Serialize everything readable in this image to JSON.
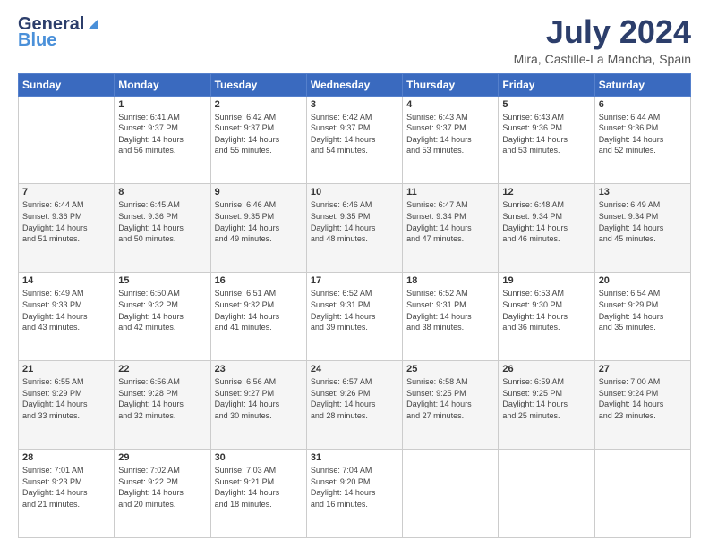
{
  "header": {
    "logo_general": "General",
    "logo_blue": "Blue",
    "main_title": "July 2024",
    "subtitle": "Mira, Castille-La Mancha, Spain"
  },
  "calendar": {
    "days_of_week": [
      "Sunday",
      "Monday",
      "Tuesday",
      "Wednesday",
      "Thursday",
      "Friday",
      "Saturday"
    ],
    "weeks": [
      [
        {
          "num": "",
          "info": ""
        },
        {
          "num": "1",
          "info": "Sunrise: 6:41 AM\nSunset: 9:37 PM\nDaylight: 14 hours\nand 56 minutes."
        },
        {
          "num": "2",
          "info": "Sunrise: 6:42 AM\nSunset: 9:37 PM\nDaylight: 14 hours\nand 55 minutes."
        },
        {
          "num": "3",
          "info": "Sunrise: 6:42 AM\nSunset: 9:37 PM\nDaylight: 14 hours\nand 54 minutes."
        },
        {
          "num": "4",
          "info": "Sunrise: 6:43 AM\nSunset: 9:37 PM\nDaylight: 14 hours\nand 53 minutes."
        },
        {
          "num": "5",
          "info": "Sunrise: 6:43 AM\nSunset: 9:36 PM\nDaylight: 14 hours\nand 53 minutes."
        },
        {
          "num": "6",
          "info": "Sunrise: 6:44 AM\nSunset: 9:36 PM\nDaylight: 14 hours\nand 52 minutes."
        }
      ],
      [
        {
          "num": "7",
          "info": "Sunrise: 6:44 AM\nSunset: 9:36 PM\nDaylight: 14 hours\nand 51 minutes."
        },
        {
          "num": "8",
          "info": "Sunrise: 6:45 AM\nSunset: 9:36 PM\nDaylight: 14 hours\nand 50 minutes."
        },
        {
          "num": "9",
          "info": "Sunrise: 6:46 AM\nSunset: 9:35 PM\nDaylight: 14 hours\nand 49 minutes."
        },
        {
          "num": "10",
          "info": "Sunrise: 6:46 AM\nSunset: 9:35 PM\nDaylight: 14 hours\nand 48 minutes."
        },
        {
          "num": "11",
          "info": "Sunrise: 6:47 AM\nSunset: 9:34 PM\nDaylight: 14 hours\nand 47 minutes."
        },
        {
          "num": "12",
          "info": "Sunrise: 6:48 AM\nSunset: 9:34 PM\nDaylight: 14 hours\nand 46 minutes."
        },
        {
          "num": "13",
          "info": "Sunrise: 6:49 AM\nSunset: 9:34 PM\nDaylight: 14 hours\nand 45 minutes."
        }
      ],
      [
        {
          "num": "14",
          "info": "Sunrise: 6:49 AM\nSunset: 9:33 PM\nDaylight: 14 hours\nand 43 minutes."
        },
        {
          "num": "15",
          "info": "Sunrise: 6:50 AM\nSunset: 9:32 PM\nDaylight: 14 hours\nand 42 minutes."
        },
        {
          "num": "16",
          "info": "Sunrise: 6:51 AM\nSunset: 9:32 PM\nDaylight: 14 hours\nand 41 minutes."
        },
        {
          "num": "17",
          "info": "Sunrise: 6:52 AM\nSunset: 9:31 PM\nDaylight: 14 hours\nand 39 minutes."
        },
        {
          "num": "18",
          "info": "Sunrise: 6:52 AM\nSunset: 9:31 PM\nDaylight: 14 hours\nand 38 minutes."
        },
        {
          "num": "19",
          "info": "Sunrise: 6:53 AM\nSunset: 9:30 PM\nDaylight: 14 hours\nand 36 minutes."
        },
        {
          "num": "20",
          "info": "Sunrise: 6:54 AM\nSunset: 9:29 PM\nDaylight: 14 hours\nand 35 minutes."
        }
      ],
      [
        {
          "num": "21",
          "info": "Sunrise: 6:55 AM\nSunset: 9:29 PM\nDaylight: 14 hours\nand 33 minutes."
        },
        {
          "num": "22",
          "info": "Sunrise: 6:56 AM\nSunset: 9:28 PM\nDaylight: 14 hours\nand 32 minutes."
        },
        {
          "num": "23",
          "info": "Sunrise: 6:56 AM\nSunset: 9:27 PM\nDaylight: 14 hours\nand 30 minutes."
        },
        {
          "num": "24",
          "info": "Sunrise: 6:57 AM\nSunset: 9:26 PM\nDaylight: 14 hours\nand 28 minutes."
        },
        {
          "num": "25",
          "info": "Sunrise: 6:58 AM\nSunset: 9:25 PM\nDaylight: 14 hours\nand 27 minutes."
        },
        {
          "num": "26",
          "info": "Sunrise: 6:59 AM\nSunset: 9:25 PM\nDaylight: 14 hours\nand 25 minutes."
        },
        {
          "num": "27",
          "info": "Sunrise: 7:00 AM\nSunset: 9:24 PM\nDaylight: 14 hours\nand 23 minutes."
        }
      ],
      [
        {
          "num": "28",
          "info": "Sunrise: 7:01 AM\nSunset: 9:23 PM\nDaylight: 14 hours\nand 21 minutes."
        },
        {
          "num": "29",
          "info": "Sunrise: 7:02 AM\nSunset: 9:22 PM\nDaylight: 14 hours\nand 20 minutes."
        },
        {
          "num": "30",
          "info": "Sunrise: 7:03 AM\nSunset: 9:21 PM\nDaylight: 14 hours\nand 18 minutes."
        },
        {
          "num": "31",
          "info": "Sunrise: 7:04 AM\nSunset: 9:20 PM\nDaylight: 14 hours\nand 16 minutes."
        },
        {
          "num": "",
          "info": ""
        },
        {
          "num": "",
          "info": ""
        },
        {
          "num": "",
          "info": ""
        }
      ]
    ]
  }
}
